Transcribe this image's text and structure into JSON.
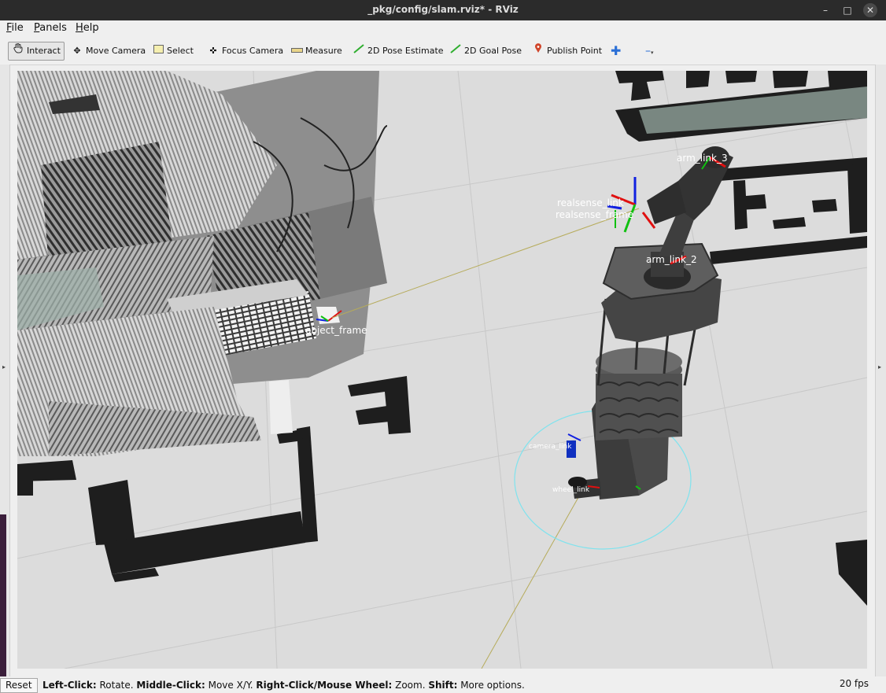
{
  "window": {
    "title": "_pkg/config/slam.rviz* - RViz"
  },
  "menu": [
    {
      "label": "File",
      "mnemonic": "F",
      "rest": "ile"
    },
    {
      "label": "Panels",
      "mnemonic": "P",
      "rest": "anels"
    },
    {
      "label": "Help",
      "mnemonic": "H",
      "rest": "elp"
    }
  ],
  "toolbar": {
    "interact": "Interact",
    "move_camera": "Move Camera",
    "select": "Select",
    "focus_camera": "Focus Camera",
    "measure": "Measure",
    "pose_estimate": "2D Pose Estimate",
    "goal_pose": "2D Goal Pose",
    "publish_point": "Publish Point"
  },
  "frames": {
    "arm_top": "arm_link_3",
    "arm_mid": "arm_link_2",
    "realsense_1": "realsense_link",
    "realsense_2": "realsense_frame",
    "object_frame": "object_frame",
    "camera": "camera_link",
    "wheel": "wheel_link"
  },
  "status": {
    "reset_label": "Reset",
    "hint_1_key": "Left-Click:",
    "hint_1_val": " Rotate. ",
    "hint_2_key": "Middle-Click:",
    "hint_2_val": " Move X/Y. ",
    "hint_3_key": "Right-Click/Mouse Wheel:",
    "hint_3_val": " Zoom. ",
    "hint_4_key": "Shift:",
    "hint_4_val": " More options.",
    "fps": "20 fps"
  },
  "colors": {
    "titlebar": "#2b2b2b",
    "viewport_bg": "#dcdcdc",
    "occupied_cell": "#1e1e1e",
    "laser_ring": "#7fe3ee",
    "axis_x": "#e01010",
    "axis_y": "#10c010",
    "axis_z": "#1020e0"
  }
}
